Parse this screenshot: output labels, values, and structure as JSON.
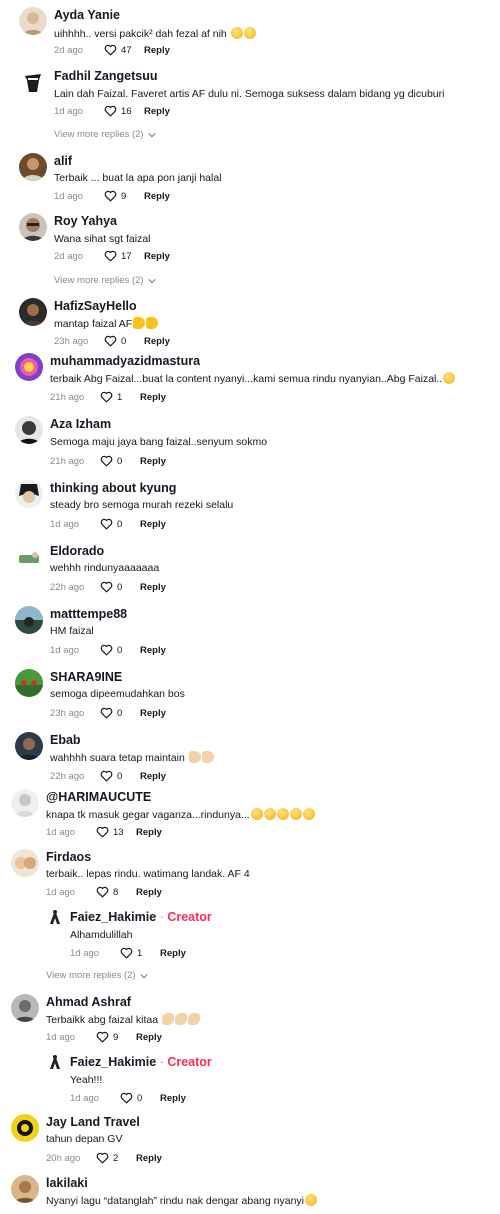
{
  "labels": {
    "reply": "Reply",
    "creator": "Creator",
    "dot": "·"
  },
  "comments": [
    {
      "user": "Ayda Yanie",
      "text": "uihhhh.. versi pakcik² dah fezal af nih",
      "time": "2d ago",
      "likes": "47",
      "more_replies": ""
    },
    {
      "user": "Fadhil Zangetsuu",
      "text": "Lain dah Faizal. Faveret artis AF dulu ni. Semoga suksess dalam bidang yg dicuburi",
      "time": "1d ago",
      "likes": "16",
      "more_replies": "View more replies (2)"
    },
    {
      "user": "alif",
      "text": "Terbaik ... buat la apa pon janji halal",
      "time": "1d ago",
      "likes": "9",
      "more_replies": ""
    },
    {
      "user": "Roy Yahya",
      "text": "Wana sihat sgt faizal",
      "time": "2d ago",
      "likes": "17",
      "more_replies": "View more replies (2)"
    },
    {
      "user": "HafizSayHello",
      "text": "mantap faizal AF",
      "time": "23h ago",
      "likes": "0",
      "more_replies": ""
    },
    {
      "user": "muhammadyazidmastura",
      "text": "terbaik Abg Faizal...buat la content nyanyi...kami semua rindu nyanyian..Abg Faizal..",
      "time": "21h ago",
      "likes": "1",
      "more_replies": ""
    },
    {
      "user": "Aza Izham",
      "text": "Semoga maju jaya bang faizal..senyum sokmo",
      "time": "21h ago",
      "likes": "0",
      "more_replies": ""
    },
    {
      "user": "thinking about kyung",
      "text": "steady bro semoga murah rezeki selalu",
      "time": "1d ago",
      "likes": "0",
      "more_replies": ""
    },
    {
      "user": "Eldorado",
      "text": "wehhh rindunyaaaaaaa",
      "time": "22h ago",
      "likes": "0",
      "more_replies": ""
    },
    {
      "user": "matttempe88",
      "text": "HM faizal",
      "time": "1d ago",
      "likes": "0",
      "more_replies": ""
    },
    {
      "user": "SHARA9INE",
      "text": "semoga dipeemudahkan bos",
      "time": "23h ago",
      "likes": "0",
      "more_replies": ""
    },
    {
      "user": "Ebab",
      "text": "wahhhh suara tetap maintain",
      "time": "22h ago",
      "likes": "0",
      "more_replies": ""
    },
    {
      "user": "@HARIMAUCUTE",
      "text": "knapa tk masuk gegar vaganza...rindunya...",
      "time": "1d ago",
      "likes": "13",
      "more_replies": ""
    },
    {
      "user": "Firdaos",
      "text": "terbaik.. lepas rindu. watimang landak. AF 4",
      "time": "1d ago",
      "likes": "8",
      "more_replies": ""
    },
    {
      "user": "Faiez_Hakimie",
      "text": "Alhamdulillah",
      "time": "1d ago",
      "likes": "1",
      "more_replies": "View more replies (2)"
    },
    {
      "user": "Ahmad Ashraf",
      "text": "Terbaikk abg faizal kitaa",
      "time": "1d ago",
      "likes": "9",
      "more_replies": ""
    },
    {
      "user": "Faiez_Hakimie",
      "text": "Yeah!!!",
      "time": "1d ago",
      "likes": "0",
      "more_replies": ""
    },
    {
      "user": "Jay Land Travel",
      "text": "tahun depan GV",
      "time": "20h ago",
      "likes": "2",
      "more_replies": ""
    },
    {
      "user": "lakilaki",
      "text": "Nyanyi lagu “datanglah” rindu nak dengar abang nyanyi",
      "time": "",
      "likes": "",
      "more_replies": ""
    }
  ]
}
